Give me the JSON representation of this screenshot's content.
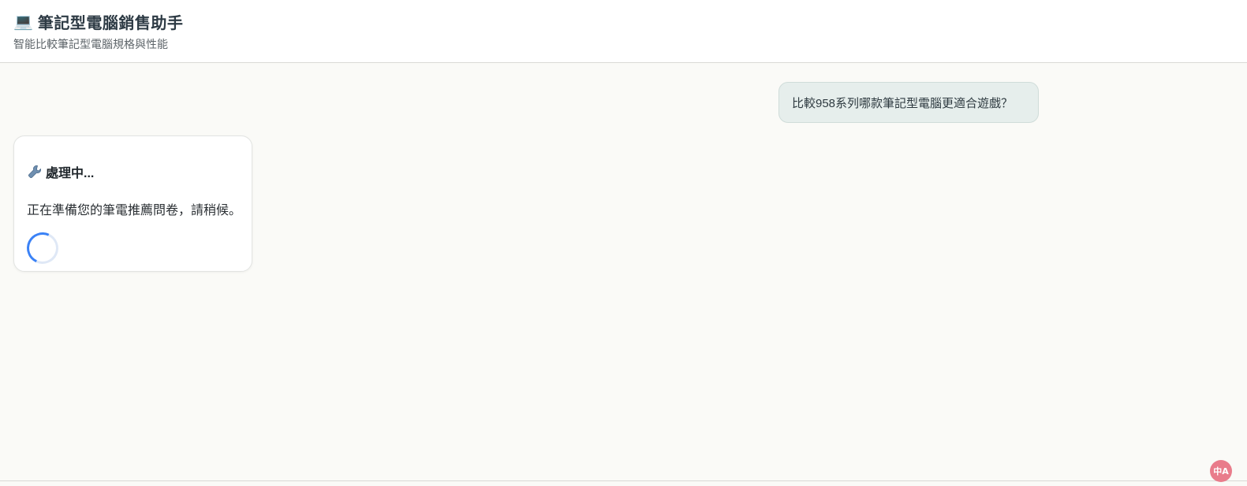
{
  "header": {
    "icon": "laptop-icon",
    "icon_glyph": "💻",
    "title": "筆記型電腦銷售助手",
    "subtitle": "智能比較筆記型電腦規格與性能"
  },
  "chat": {
    "user_message": "比較958系列哪款筆記型電腦更適合遊戲？",
    "bot_status": {
      "icon": "wrench-icon",
      "title": "處理中...",
      "text": "正在準備您的筆電推薦問卷，請稍候。",
      "loading_icon": "spinner-icon"
    }
  },
  "widgets": {
    "translate_icon": "translate-icon",
    "translate_glyph": "中A"
  },
  "colors": {
    "accent": "#3b82f6",
    "user_bubble_bg": "#e6eeec",
    "translate_badge": "#e97c8b"
  }
}
